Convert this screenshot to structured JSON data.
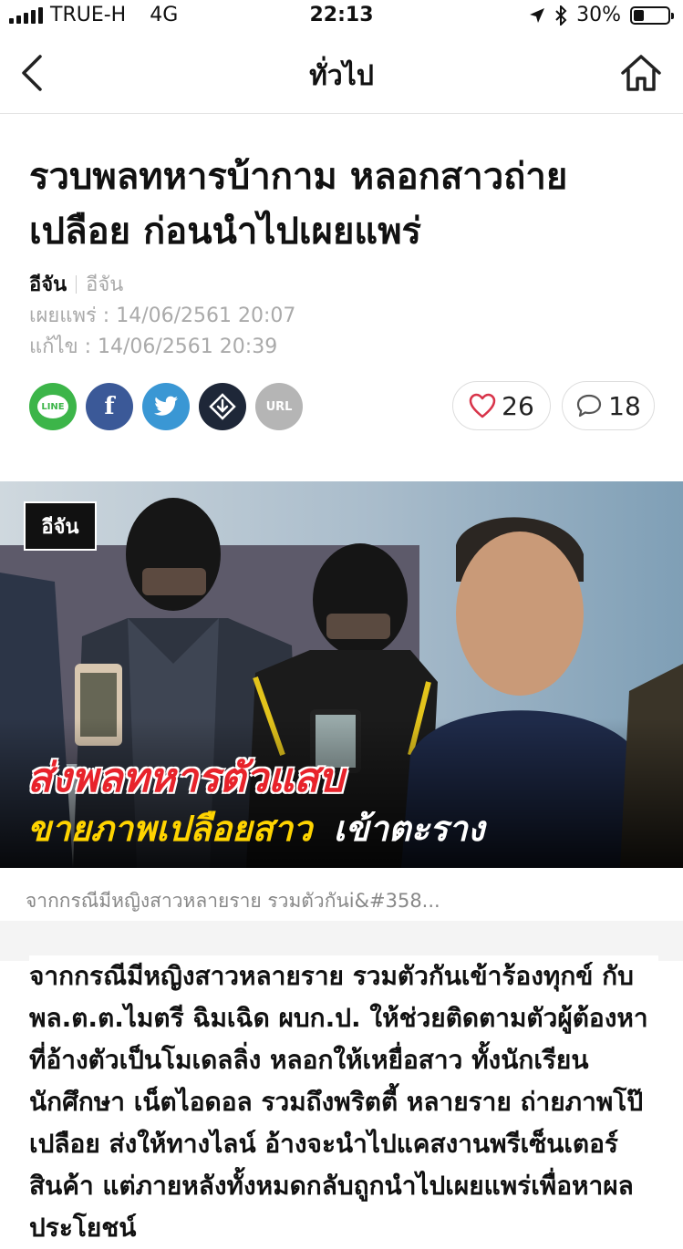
{
  "status_bar": {
    "carrier": "TRUE-H",
    "network": "4G",
    "time": "22:13",
    "battery": "30%"
  },
  "nav": {
    "title": "ทั่วไป",
    "back_icon": "chevron-left-icon",
    "home_icon": "home-icon"
  },
  "article": {
    "headline": "รวบพลทหารบ้ากาม หลอกสาวถ่ายเปลือย ก่อนนำไปเผยแพร่",
    "author_primary": "อีจัน",
    "author_secondary": "อีจัน",
    "published": "เผยแพร่ : 14/06/2561 20:07",
    "edited": "แก้ไข : 14/06/2561 20:39",
    "likes": "26",
    "comments": "18",
    "share": {
      "line": "LINE",
      "facebook": "f",
      "url": "URL"
    },
    "image": {
      "logo": "อีจัน",
      "overlay_line1": "ส่งพลทหารตัวแสบ",
      "overlay_line2a": "ขายภาพเปลือยสาว",
      "overlay_line2b": "เข้าตะราง"
    },
    "caption": "จากกรณีมีหญิงสาวหลายราย รวมตัวกันi&#358...",
    "body": "จากกรณีมีหญิงสาวหลายราย รวมตัวกันเข้าร้องทุกข์ กับ พล.ต.ต.ไมตรี ฉิมเฉิด ผบก.ป. ให้ช่วยติดตามตัวผู้ต้องหา ที่อ้างตัวเป็นโมเดลลิ่ง หลอกให้เหยื่อสาว ทั้งนักเรียน นักศึกษา เน็ตไอดอล รวมถึงพริตตี้ หลายราย ถ่ายภาพโป๊เปลือย ส่งให้ทางไลน์ อ้างจะนำไปแคสงานพรีเซ็นเตอร์สินค้า แต่ภายหลังทั้งหมดกลับถูกนำไปเผยแพร่เพื่อหาผลประโยชน์"
  },
  "colors": {
    "line_green": "#3cb549",
    "facebook_blue": "#3b5998",
    "twitter_blue": "#3a97d4",
    "heart_red": "#d8344a",
    "overlay_red": "#e8232b",
    "overlay_yellow": "#ffd400"
  }
}
